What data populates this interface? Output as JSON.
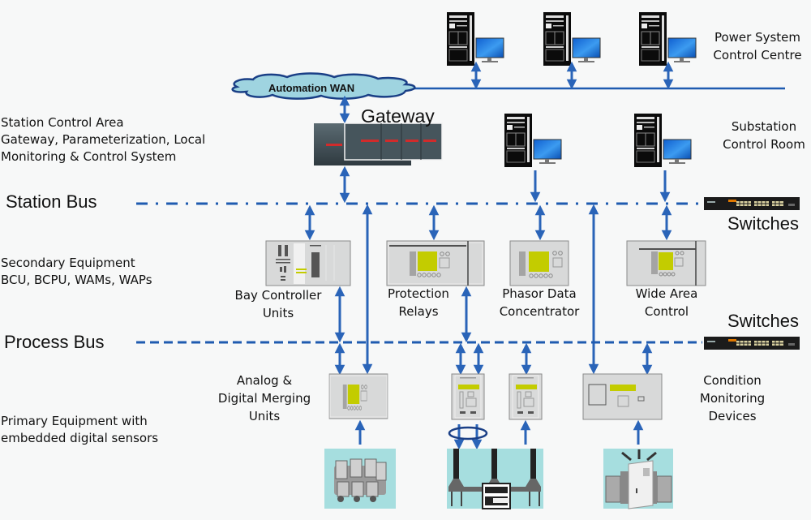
{
  "diagram": {
    "type": "substation-automation-architecture",
    "colors": {
      "line": "#1f5bb0",
      "arrow": "#2a64b8",
      "background": "#f7f8f8",
      "screen_yellow": "#c3cc00",
      "cloud_fill": "#9fd4e0",
      "cloud_stroke": "#1a3f86",
      "primary_bg": "#a6dedf",
      "device_gray": "#d7d8d8"
    }
  },
  "labels": {
    "power_system_control_centre": [
      "Power System",
      "Control Centre"
    ],
    "automation_wan": "Automation WAN",
    "gateway": "Gateway",
    "station_control_area": [
      "Station Control Area",
      "Gateway, Parameterization, Local",
      "Monitoring & Control System"
    ],
    "substation_control_room": [
      "Substation",
      "Control Room"
    ],
    "station_bus": "Station Bus",
    "switches_station": "Switches",
    "secondary_equipment": [
      "Secondary Equipment",
      "BCU, BCPU, WAMs, WAPs"
    ],
    "bay_controller_units": [
      "Bay Controller",
      "Units"
    ],
    "protection_relays": [
      "Protection",
      "Relays"
    ],
    "phasor_data_concentrator": [
      "Phasor Data",
      "Concentrator"
    ],
    "wide_area_control": [
      "Wide Area",
      "Control"
    ],
    "switches_process": "Switches",
    "process_bus": "Process Bus",
    "analog_digital_merging_units": [
      "Analog &",
      "Digital Merging",
      "Units"
    ],
    "condition_monitoring_devices": [
      "Condition",
      "Monitoring",
      "Devices"
    ],
    "primary_equipment": [
      "Primary Equipment with",
      "embedded digital sensors"
    ]
  },
  "nodes": {
    "control_centre_workstations": 3,
    "substation_workstations": 2,
    "secondary_devices": [
      "Bay Controller Units",
      "Protection Relays",
      "Phasor Data Concentrator",
      "Wide Area Control"
    ],
    "merging_units": 4,
    "primary_equipment": [
      "GIS switchgear",
      "Circuit breaker / disconnector",
      "Power transformer"
    ]
  }
}
